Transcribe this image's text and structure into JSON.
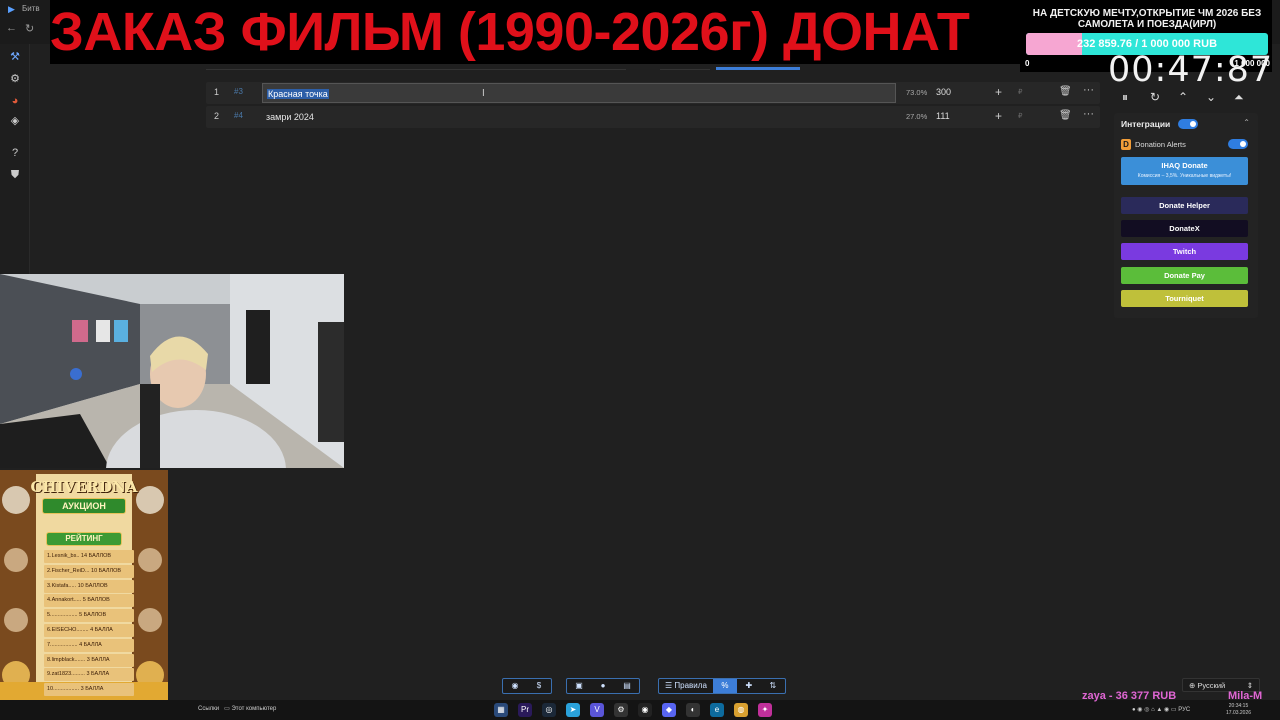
{
  "browser": {
    "tab_label": "Битв"
  },
  "banner": {
    "text": "ЗАКАЗ ФИЛЬМ (1990-2026г) ДОНАТ"
  },
  "goal": {
    "title": "НА ДЕТСКУЮ МЕЧТУ,ОТКРЫТИЕ ЧМ 2026 БЕЗ САМОЛЕТА И ПОЕЗДА(ИРЛ)",
    "progress_text": "232 859.76 / 1 000 000 RUB",
    "progress_fraction": 0.233,
    "min_label": "0",
    "max_label": "1 000 000",
    "fill_color": "#f6a6d2",
    "track_color": "#2ee6d8"
  },
  "timer": {
    "value": "00:47:87"
  },
  "lots": [
    {
      "index": "1",
      "hash": "#3",
      "name": "Красная точка",
      "percent": "73.0%",
      "amount": "300",
      "editing": true
    },
    {
      "index": "2",
      "hash": "#4",
      "name": "замри 2024",
      "percent": "27.0%",
      "amount": "111",
      "editing": false
    }
  ],
  "lot_icons": {
    "add": "+",
    "currency": "₽",
    "delete": "trash-icon",
    "more": "···"
  },
  "controls": {
    "pause": "⏸",
    "reset": "↻",
    "up": "⌃",
    "down": "⌄",
    "collapse": "⏶"
  },
  "integrations": {
    "title": "Интеграции",
    "donation_alerts": "Donation Alerts",
    "services": [
      {
        "label": "IHAQ Donate",
        "sub": "Комиссия – 3,5%. Уникальные виджеты!",
        "color": "#3b8fd8"
      },
      {
        "label": "Donate Helper",
        "color": "#2a2a5a"
      },
      {
        "label": "DonateX",
        "color": "#120d22"
      },
      {
        "label": "Twitch",
        "color": "#7a3ae0"
      },
      {
        "label": "Donate Pay",
        "color": "#5bbd3a"
      },
      {
        "label": "Tourniquet",
        "color": "#bfc03a"
      }
    ]
  },
  "rating": {
    "title": "CHIVERDNA",
    "subtitle": "АУКЦИОН",
    "badge": "РЕЙТИНГ",
    "entries": [
      "1.Lesnik_bs.. 14 БАЛЛОВ",
      "2.Fischer_ReiD... 10 БАЛЛОВ",
      "3.Kistafa..... 10 БАЛЛОВ",
      "4.Annakort..... 5 БАЛЛОВ",
      "5.................. 5 БАЛЛОВ",
      "6.EISECHO........ 4 БАЛЛА",
      "7.................. 4 БАЛЛА",
      "8.limpblack....... 3 БАЛЛА",
      "9.zat1823......... 3 БАЛЛА",
      "10................. 3 БАЛЛА"
    ]
  },
  "bottom_toolbar": {
    "rules_label": "Правила",
    "percent_label": "%"
  },
  "language": {
    "selected": "Русский"
  },
  "taskbar": {
    "links_label": "Ссылки",
    "computer_label": "Этот компьютер",
    "lang": "РУС",
    "time": "20:34:15",
    "date": "17.03.2026"
  },
  "donor_overlay": {
    "left": "zaya - 36 377 RUB",
    "right": "Mila-M"
  }
}
